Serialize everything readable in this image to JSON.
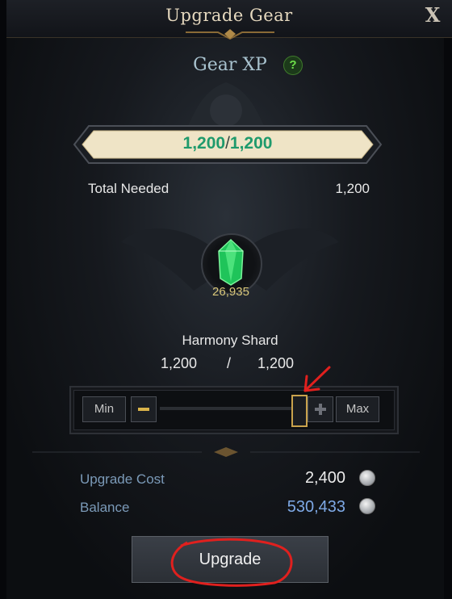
{
  "window": {
    "title": "Upgrade Gear",
    "close_label": "X"
  },
  "header": {
    "section_title": "Gear XP",
    "help_label": "?"
  },
  "xp_bar": {
    "current": "1,200",
    "separator": "/",
    "max": "1,200",
    "fill_fraction": 1.0
  },
  "total_needed": {
    "label": "Total Needed",
    "value": "1,200"
  },
  "material": {
    "icon": "harmony-shard-icon",
    "owned_count": "26,935",
    "name": "Harmony Shard",
    "selected": "1,200",
    "separator": "/",
    "max": "1,200"
  },
  "quantity_slider": {
    "min_label": "Min",
    "max_label": "Max",
    "fraction": 1.0
  },
  "costs": {
    "upgrade_cost_label": "Upgrade Cost",
    "upgrade_cost_value": "2,400",
    "balance_label": "Balance",
    "balance_value": "530,433",
    "currency_icon": "silver-coin-icon"
  },
  "actions": {
    "upgrade_label": "Upgrade"
  },
  "colors": {
    "xp_text": "#1f9a6c",
    "balance_value": "#7ea9e6",
    "label_blue": "#7b9ab8",
    "handle_border": "#c9a24c",
    "annotation_red": "#e0201e"
  }
}
